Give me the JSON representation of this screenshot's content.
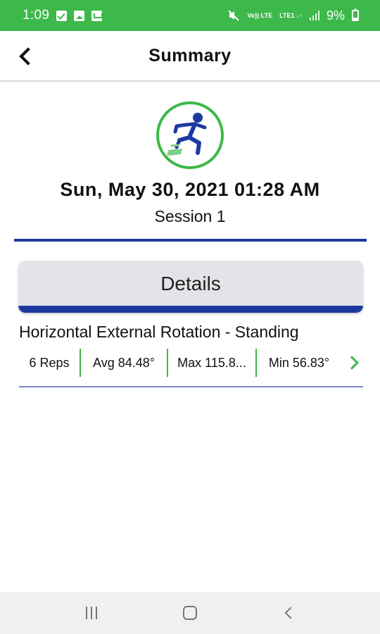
{
  "status_bar": {
    "time": "1:09",
    "icons": [
      "checkbox-icon",
      "image-icon",
      "mail-icon"
    ],
    "right_icons": [
      "mute-icon",
      "volte-icon",
      "lte-icon",
      "signal-icon",
      "battery-icon"
    ],
    "volte_text": "Vo)) LTE",
    "lte_text": "LTE1 ↓↑",
    "battery": "9%"
  },
  "app_bar": {
    "title": "Summary",
    "back_icon": "back-chevron-icon"
  },
  "session": {
    "date": "Sun, May 30, 2021 01:28 AM",
    "name": "Session 1"
  },
  "details": {
    "label": "Details"
  },
  "exercise": {
    "name": "Horizontal External Rotation - Standing",
    "reps": "6 Reps",
    "avg": "Avg 84.48°",
    "max": "Max 115.8...",
    "min": "Min 56.83°"
  },
  "colors": {
    "status_green": "#3db84a",
    "accent_blue": "#1c3a9e",
    "card_gray": "#e4e4e8"
  },
  "nav_bar": {
    "icons": [
      "recents-icon",
      "home-icon",
      "back-icon"
    ]
  }
}
